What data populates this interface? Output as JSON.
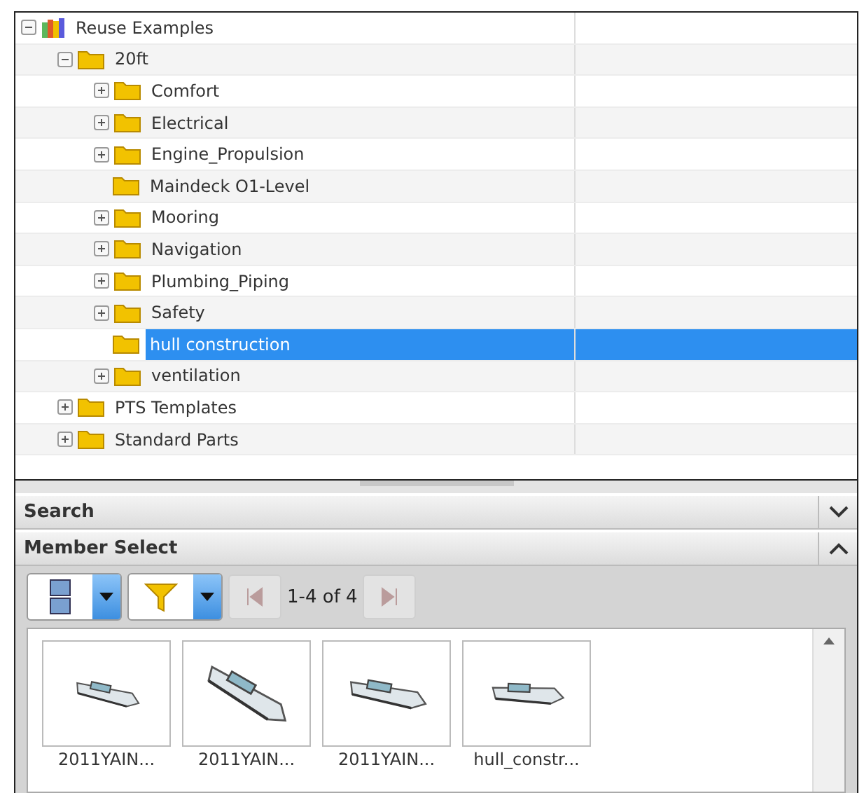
{
  "tree": [
    {
      "label": "Reuse Examples",
      "kind": "library",
      "expanded": true,
      "selected": false,
      "children": [
        {
          "label": "20ft",
          "kind": "folder",
          "expanded": true,
          "selected": false,
          "children": [
            {
              "label": "Comfort",
              "kind": "folder",
              "expanded": false,
              "selected": false
            },
            {
              "label": "Electrical",
              "kind": "folder",
              "expanded": false,
              "selected": false
            },
            {
              "label": "Engine_Propulsion",
              "kind": "folder",
              "expanded": false,
              "selected": false
            },
            {
              "label": "Maindeck O1-Level",
              "kind": "folder",
              "selected": false
            },
            {
              "label": "Mooring",
              "kind": "folder",
              "expanded": false,
              "selected": false
            },
            {
              "label": "Navigation",
              "kind": "folder",
              "expanded": false,
              "selected": false
            },
            {
              "label": "Plumbing_Piping",
              "kind": "folder",
              "expanded": false,
              "selected": false
            },
            {
              "label": "Safety",
              "kind": "folder",
              "expanded": false,
              "selected": false
            },
            {
              "label": "hull construction",
              "kind": "folder",
              "selected": true
            },
            {
              "label": "ventilation",
              "kind": "folder",
              "expanded": false,
              "selected": false
            }
          ]
        },
        {
          "label": "PTS Templates",
          "kind": "folder",
          "expanded": false,
          "selected": false
        },
        {
          "label": "Standard Parts",
          "kind": "folder",
          "expanded": false,
          "selected": false
        }
      ]
    }
  ],
  "sections": [
    {
      "title": "Search",
      "expanded": false
    },
    {
      "title": "Member Select",
      "expanded": true
    }
  ],
  "pager": {
    "range": "1-4 of 4"
  },
  "members": [
    {
      "name": "2011YAIN...",
      "kind": "picture"
    },
    {
      "name": "2011YAIN...",
      "kind": "picture"
    },
    {
      "name": "2011YAIN...",
      "kind": "picture"
    },
    {
      "name": "hull_constr...",
      "kind": "picture"
    }
  ]
}
